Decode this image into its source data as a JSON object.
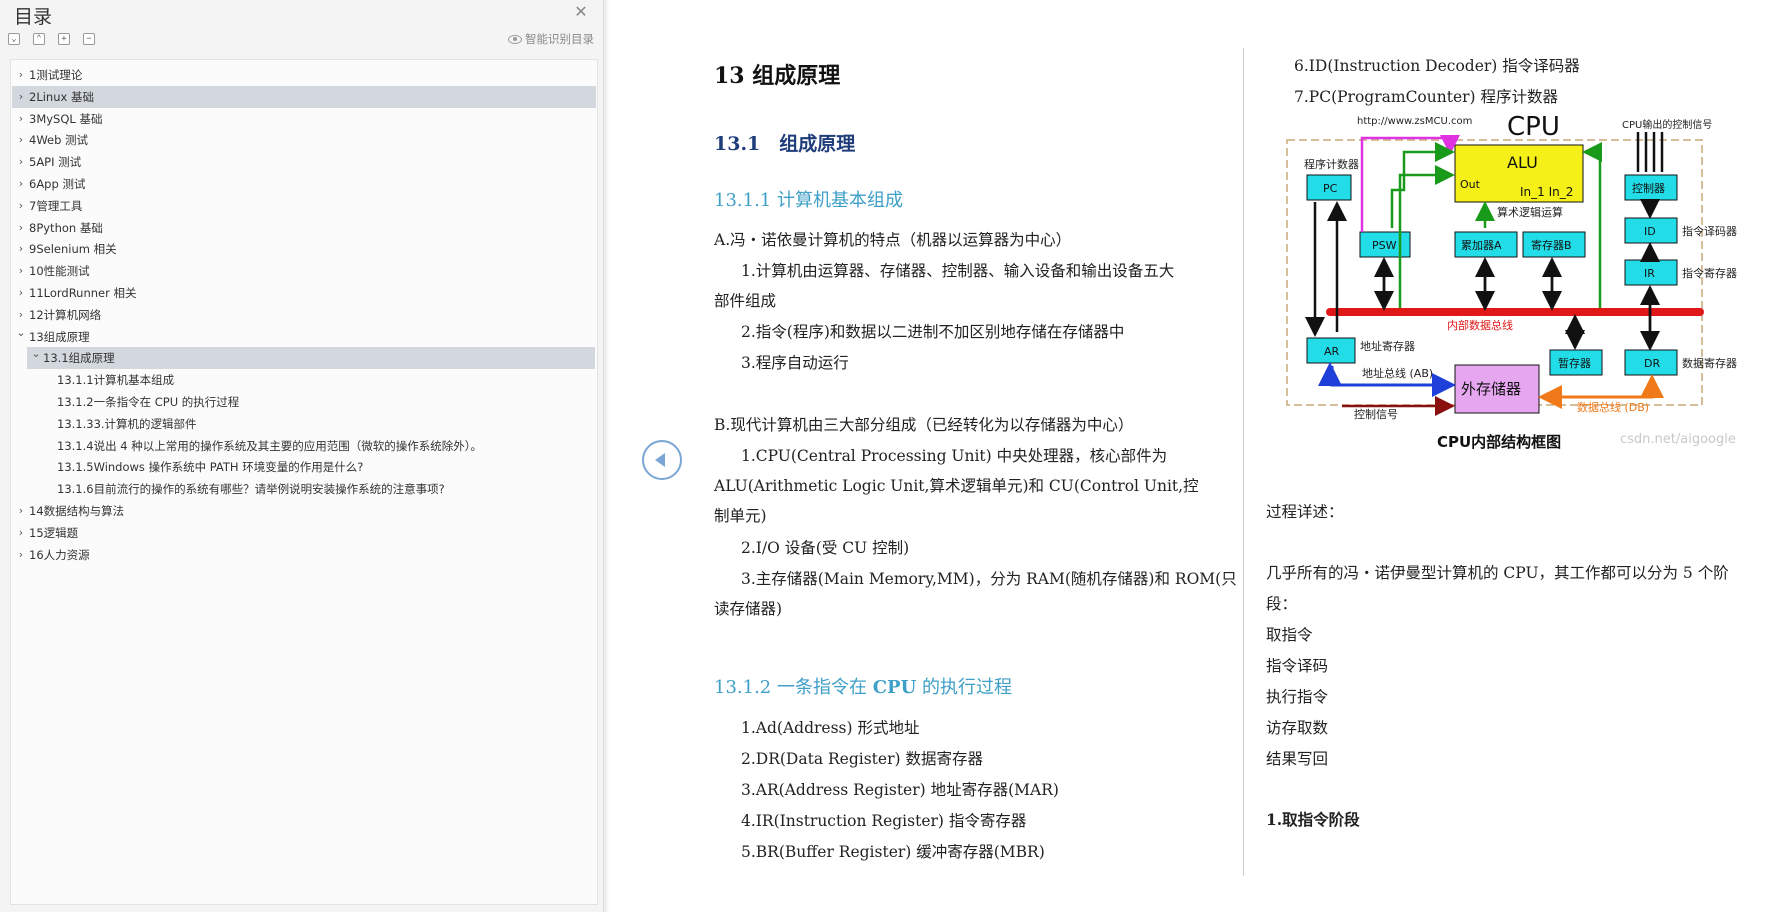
{
  "sidebar": {
    "title": "目录",
    "smart_toc_label": "智能识别目录",
    "tools": [
      "expand",
      "collapse",
      "add",
      "remove"
    ],
    "items": [
      {
        "label": "1测试理论",
        "level": 0,
        "expanded": false,
        "selected": false
      },
      {
        "label": "2Linux 基础",
        "level": 0,
        "expanded": false,
        "selected": true
      },
      {
        "label": "3MySQL 基础",
        "level": 0,
        "expanded": false,
        "selected": false
      },
      {
        "label": "4Web 测试",
        "level": 0,
        "expanded": false,
        "selected": false
      },
      {
        "label": "5API 测试",
        "level": 0,
        "expanded": false,
        "selected": false
      },
      {
        "label": "6App 测试",
        "level": 0,
        "expanded": false,
        "selected": false
      },
      {
        "label": "7管理工具",
        "level": 0,
        "expanded": false,
        "selected": false
      },
      {
        "label": "8Python 基础",
        "level": 0,
        "expanded": false,
        "selected": false
      },
      {
        "label": "9Selenium 相关",
        "level": 0,
        "expanded": false,
        "selected": false
      },
      {
        "label": "10性能测试",
        "level": 0,
        "expanded": false,
        "selected": false
      },
      {
        "label": "11LordRunner 相关",
        "level": 0,
        "expanded": false,
        "selected": false
      },
      {
        "label": "12计算机网络",
        "level": 0,
        "expanded": false,
        "selected": false
      },
      {
        "label": "13组成原理",
        "level": 0,
        "expanded": true,
        "selected": false
      },
      {
        "label": "13.1组成原理",
        "level": 1,
        "expanded": true,
        "selected": true
      },
      {
        "label": "13.1.1计算机基本组成",
        "level": 2,
        "expanded": null,
        "selected": false
      },
      {
        "label": "13.1.2一条指令在 CPU 的执行过程",
        "level": 2,
        "expanded": null,
        "selected": false
      },
      {
        "label": "13.1.33.计算机的逻辑部件",
        "level": 2,
        "expanded": null,
        "selected": false
      },
      {
        "label": "13.1.4说出 4 种以上常用的操作系统及其主要的应用范围（微软的操作系统除外）。",
        "level": 2,
        "expanded": null,
        "selected": false
      },
      {
        "label": "13.1.5Windows 操作系统中 PATH 环境变量的作用是什么?",
        "level": 2,
        "expanded": null,
        "selected": false
      },
      {
        "label": "13.1.6目前流行的操作的系统有哪些？请举例说明安装操作系统的注意事项?",
        "level": 2,
        "expanded": null,
        "selected": false
      },
      {
        "label": "14数据结构与算法",
        "level": 0,
        "expanded": false,
        "selected": false
      },
      {
        "label": "15逻辑题",
        "level": 0,
        "expanded": false,
        "selected": false
      },
      {
        "label": "16人力资源",
        "level": 0,
        "expanded": false,
        "selected": false
      }
    ]
  },
  "doc": {
    "left": {
      "h1": "13 组成原理",
      "h2": "13.1　组成原理",
      "h3a": "13.1.1 计算机基本组成",
      "a_title": "A.冯・诺依曼计算机的特点（机器以运算器为中心）",
      "a1_line1": "1.计算机由运算器、存储器、控制器、输入设备和输出设备五大",
      "a1_line2": "部件组成",
      "a2": "2.指令(程序)和数据以二进制不加区别地存储在存储器中",
      "a3": "3.程序自动运行",
      "b_title": "B.现代计算机由三大部分组成（已经转化为以存储器为中心）",
      "b1_line1": "1.CPU(Central Processing Unit) 中央处理器，核心部件为",
      "b1_line2": "ALU(Arithmetic Logic Unit,算术逻辑单元)和 CU(Control Unit,控",
      "b1_line3": "制单元)",
      "b2": "2.I/O 设备(受 CU 控制)",
      "b3_line1": "3.主存储器(Main Memory,MM)，分为 RAM(随机存储器)和 ROM(只",
      "b3_line2": "读存储器)",
      "h3b_prefix": "13.1.2 一条指令在 ",
      "h3b_cpu": "CPU",
      "h3b_suffix": " 的执行过程",
      "reg1": "1.Ad(Address) 形式地址",
      "reg2": "2.DR(Data Register) 数据寄存器",
      "reg3": "3.AR(Address Register) 地址寄存器(MAR)",
      "reg4": "4.IR(Instruction Register) 指令寄存器",
      "reg5": "5.BR(Buffer Register) 缓冲寄存器(MBR)"
    },
    "right": {
      "reg6": "6.ID(Instruction Decoder) 指令译码器",
      "reg7": "7.PC(ProgramCounter) 程序计数器",
      "process_title": "过程详述：",
      "process_line1": "几乎所有的冯・诺伊曼型计算机的 CPU，其工作都可以分为 5 个阶",
      "process_line2": "段：",
      "stage1": "取指令",
      "stage2": "指令译码",
      "stage3": "执行指令",
      "stage4": "访存取数",
      "stage5": "结果写回",
      "h_fetch": "1.取指令阶段"
    },
    "diagram": {
      "url_text": "http://www.zsMCU.com",
      "cpu_title": "CPU",
      "control_out_label": "CPU输出的控制信号",
      "pc_label": "程序计数器",
      "pc": "PC",
      "alu": "ALU",
      "alu_out": "Out",
      "alu_in": "In_1 In_2",
      "alu_caption": "算术逻辑运算",
      "psw": "PSW",
      "acc_a": "累加器A",
      "reg_b": "寄存器B",
      "controller": "控制器",
      "id": "ID",
      "id_label": "指令译码器",
      "ir": "IR",
      "ir_label": "指令寄存器",
      "internal_bus": "内部数据总线",
      "ar": "AR",
      "ar_label": "地址寄存器",
      "temp": "暂存器",
      "dr": "DR",
      "dr_label": "数据寄存器",
      "addr_bus": "地址总线 (AB)",
      "ext_mem": "外存储器",
      "data_bus": "数据总线 (DB)",
      "ctrl_signal": "控制信号",
      "caption": "CPU内部结构框图",
      "watermark": "csdn.net/aigoogle"
    }
  }
}
